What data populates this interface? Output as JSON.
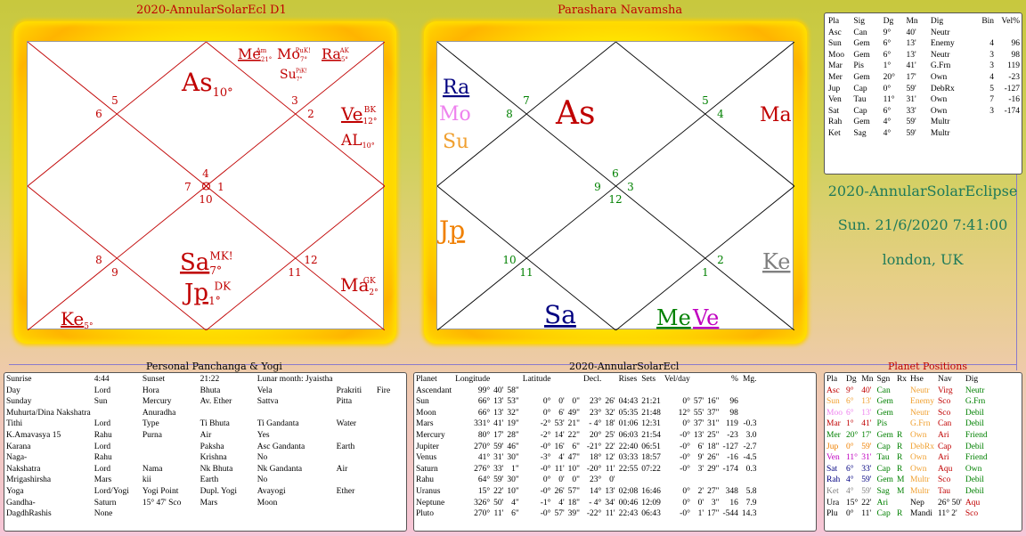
{
  "d1": {
    "title": "2020-AnnularSolarEcl D1",
    "houses": [
      "5",
      "6",
      "3",
      "2",
      "4",
      "7",
      "1",
      "10",
      "8",
      "9",
      "11",
      "12"
    ],
    "planets": [
      {
        "id": "me",
        "text": "Me",
        "sup": "Am",
        "sub": "21°",
        "color": "#c00000",
        "underline": true
      },
      {
        "id": "mo",
        "text": "Mo",
        "sup": "PuK!",
        "sub": "7°",
        "color": "#c00000",
        "underline": false
      },
      {
        "id": "ra",
        "text": "Ra",
        "sup": "AK",
        "sub": "5°",
        "color": "#c00000",
        "underline": true
      },
      {
        "id": "su",
        "text": "Su",
        "sup": "PiK!",
        "sub": "7°",
        "color": "#c00000",
        "underline": false
      },
      {
        "id": "as",
        "text": "As",
        "sup": "",
        "sub": "10°",
        "color": "#c00000",
        "underline": false
      },
      {
        "id": "ve",
        "text": "Ve",
        "sup": "BK",
        "sub": "12°",
        "color": "#c00000",
        "underline": true
      },
      {
        "id": "al",
        "text": "AL",
        "sup": "",
        "sub": "10°",
        "color": "#c00000",
        "underline": false
      },
      {
        "id": "sa",
        "text": "Sa",
        "sup": "MK!",
        "sub": "7°",
        "color": "#c00000",
        "underline": true
      },
      {
        "id": "jp",
        "text": "Jp",
        "sup": "DK",
        "sub": "1°",
        "color": "#c00000",
        "underline": true
      },
      {
        "id": "ma",
        "text": "Ma",
        "sup": "GK",
        "sub": "2°",
        "color": "#c00000",
        "underline": false
      },
      {
        "id": "ke",
        "text": "Ke",
        "sup": "",
        "sub": "5°",
        "color": "#c00000",
        "underline": true
      }
    ]
  },
  "navamsha": {
    "title": "Parashara Navamsha",
    "houses": [
      "7",
      "8",
      "5",
      "4",
      "6",
      "9",
      "3",
      "12",
      "10",
      "11",
      "2",
      "1"
    ],
    "planets": [
      {
        "id": "ra",
        "text": "Ra",
        "color": "#000080",
        "underline": true
      },
      {
        "id": "mo",
        "text": "Mo",
        "color": "#ee82ee",
        "underline": false
      },
      {
        "id": "su",
        "text": "Su",
        "color": "#f0a030",
        "underline": false
      },
      {
        "id": "as",
        "text": "As",
        "color": "#c00000",
        "underline": false
      },
      {
        "id": "ma",
        "text": "Ma",
        "color": "#c00000",
        "underline": false
      },
      {
        "id": "jp",
        "text": "Jp",
        "color": "#f08000",
        "underline": true
      },
      {
        "id": "ke",
        "text": "Ke",
        "color": "#808080",
        "underline": true
      },
      {
        "id": "sa",
        "text": "Sa",
        "color": "#000080",
        "underline": true
      },
      {
        "id": "me",
        "text": "Me",
        "color": "#008000",
        "underline": true
      },
      {
        "id": "ve",
        "text": "Ve",
        "color": "#c000c0",
        "underline": true
      }
    ]
  },
  "planet_table": {
    "headers": [
      "Pla",
      "Sig",
      "Dg",
      "Mn",
      "Dig",
      "Bin",
      "Vel%"
    ],
    "rows": [
      [
        "Asc",
        "Can",
        "9°",
        "40'",
        "Neutr",
        "",
        ""
      ],
      [
        "Sun",
        "Gem",
        "6°",
        "13'",
        "Enemy",
        "4",
        "96"
      ],
      [
        "Moo",
        "Gem",
        "6°",
        "13'",
        "Neutr",
        "3",
        "98"
      ],
      [
        "Mar",
        "Pis",
        "1°",
        "41'",
        "G.Frn",
        "3",
        "119"
      ],
      [
        "Mer",
        "Gem",
        "20°",
        "17'",
        "Own",
        "4",
        "-23"
      ],
      [
        "Jup",
        "Cap",
        "0°",
        "59'",
        "DebRx",
        "5",
        "-127"
      ],
      [
        "Ven",
        "Tau",
        "11°",
        "31'",
        "Own",
        "7",
        "-16"
      ],
      [
        "Sat",
        "Cap",
        "6°",
        "33'",
        "Own",
        "3",
        "-174"
      ],
      [
        "Rah",
        "Gem",
        "4°",
        "59'",
        "Multr",
        "",
        ""
      ],
      [
        "Ket",
        "Sag",
        "4°",
        "59'",
        "Multr",
        "",
        ""
      ]
    ]
  },
  "event": {
    "name": "2020-AnnularSolarEclipse",
    "datetime": "Sun. 21/6/2020  7:41:00",
    "place": "london, UK"
  },
  "panchanga": {
    "title": "Personal Panchanga & Yogi",
    "rows": [
      [
        "Sunrise",
        "4:44",
        "Sunset",
        "21:22",
        "Lunar month: Jyaistha",
        "",
        ""
      ],
      [
        "Day",
        "Lord",
        "Hora",
        "Bhuta",
        "Vela",
        "Prakriti",
        "Fire"
      ],
      [
        "Sunday",
        "Sun",
        "Mercury",
        "Av. Ether",
        "Sattva",
        "Pitta",
        ""
      ],
      [
        "Muhurta/Dina Nakshatra",
        "",
        "Anuradha",
        "",
        "",
        "",
        ""
      ],
      [
        "Tithi",
        "Lord",
        "Type",
        "Ti Bhuta",
        "Ti Gandanta",
        "Water",
        ""
      ],
      [
        "K.Amavasya 15",
        "Rahu",
        "Purna",
        "Air",
        "Yes",
        "",
        ""
      ],
      [
        "Karana",
        "Lord",
        "",
        "Paksha",
        "Asc Gandanta",
        "Earth",
        ""
      ],
      [
        "Naga-",
        "Rahu",
        "",
        "Krishna",
        "No",
        "",
        ""
      ],
      [
        "Nakshatra",
        "Lord",
        "Nama",
        "Nk Bhuta",
        "Nk Gandanta",
        "Air",
        ""
      ],
      [
        "Mrigashirsha",
        "Mars",
        "kii",
        "Earth",
        "No",
        "",
        ""
      ],
      [
        "Yoga",
        "Lord/Yogi",
        "Yogi Point",
        "Dupl. Yogi",
        "Avayogi",
        "Ether",
        ""
      ],
      [
        "Gandha-",
        "Saturn",
        "15° 47' Sco",
        "Mars",
        "Moon",
        "",
        ""
      ],
      [
        "DagdhRashis",
        "None",
        "",
        "",
        "",
        "",
        ""
      ]
    ]
  },
  "ephemeris": {
    "title": "2020-AnnularSolarEcl",
    "headers": [
      "Planet",
      "Longitude",
      "",
      "",
      "Latitude",
      "",
      "",
      "Decl.",
      "",
      "Rises",
      "Sets",
      "Vel/day",
      "",
      "",
      "%",
      "Mg."
    ],
    "rows": [
      [
        "Ascendant",
        "99°",
        "40'",
        "58\"",
        "",
        "",
        "",
        "",
        "",
        "",
        "",
        "",
        "",
        "",
        "",
        ""
      ],
      [
        "Sun",
        "66°",
        "13'",
        "53\"",
        "0°",
        "0'",
        "0\"",
        "23°",
        "26'",
        "04:43",
        "21:21",
        "0°",
        "57'",
        "16\"",
        "96",
        ""
      ],
      [
        "Moon",
        "66°",
        "13'",
        "32\"",
        "0°",
        "6'",
        "49\"",
        "23°",
        "32'",
        "05:35",
        "21:48",
        "12°",
        "55'",
        "37\"",
        "98",
        ""
      ],
      [
        "Mars",
        "331°",
        "41'",
        "19\"",
        "-2°",
        "53'",
        "21\"",
        "- 4°",
        "18'",
        "01:06",
        "12:31",
        "0°",
        "37'",
        "31\"",
        "119",
        "-0.3"
      ],
      [
        "Mercury",
        "80°",
        "17'",
        "28\"",
        "-2°",
        "14'",
        "22\"",
        "20°",
        "25'",
        "06:03",
        "21:54",
        "-0°",
        "13'",
        "25\"",
        "-23",
        "3.0"
      ],
      [
        "Jupiter",
        "270°",
        "59'",
        "46\"",
        "-0°",
        "16'",
        "6\"",
        "-21°",
        "22'",
        "22:40",
        "06:51",
        "-0°",
        "6'",
        "18\"",
        "-127",
        "-2.7"
      ],
      [
        "Venus",
        "41°",
        "31'",
        "30\"",
        "-3°",
        "4'",
        "47\"",
        "18°",
        "12'",
        "03:33",
        "18:57",
        "-0°",
        "9'",
        "26\"",
        "-16",
        "-4.5"
      ],
      [
        "Saturn",
        "276°",
        "33'",
        "1\"",
        "-0°",
        "11'",
        "10\"",
        "-20°",
        "11'",
        "22:55",
        "07:22",
        "-0°",
        "3'",
        "29\"",
        "-174",
        "0.3"
      ],
      [
        "Rahu",
        "64°",
        "59'",
        "30\"",
        "0°",
        "0'",
        "0\"",
        "23°",
        "0'",
        "",
        "",
        "",
        "",
        "",
        "",
        ""
      ],
      [
        "Uranus",
        "15°",
        "22'",
        "10\"",
        "-0°",
        "26'",
        "57\"",
        "14°",
        "13'",
        "02:08",
        "16:46",
        "0°",
        "2'",
        "27\"",
        "348",
        "5.8"
      ],
      [
        "Neptune",
        "326°",
        "50'",
        "4\"",
        "-1°",
        "4'",
        "18\"",
        "- 4°",
        "34'",
        "00:46",
        "12:09",
        "0°",
        "0'",
        "3\"",
        "16",
        "7.9"
      ],
      [
        "Pluto",
        "270°",
        "11'",
        "6\"",
        "-0°",
        "57'",
        "39\"",
        "-22°",
        "11'",
        "22:43",
        "06:43",
        "-0°",
        "1'",
        "17\"",
        "-544",
        "14.3"
      ]
    ]
  },
  "positions": {
    "title": "Planet Positions",
    "headers": [
      "Pla",
      "Dg",
      "Mn",
      "Sgn",
      "Rx",
      "Hse",
      "Nav",
      "Dig"
    ],
    "rows": [
      {
        "cells": [
          "Asc",
          "9°",
          "40'",
          "Can",
          "",
          "Neutr",
          "Virg",
          "Neutr"
        ],
        "color": "#c00000"
      },
      {
        "cells": [
          "Sun",
          "6°",
          "13'",
          "Gem",
          "",
          "Enemy",
          "Sco",
          "G.Frn"
        ],
        "color": "#f0a030"
      },
      {
        "cells": [
          "Moo",
          "6°",
          "13'",
          "Gem",
          "",
          "Neutr",
          "Sco",
          "Debil"
        ],
        "color": "#ee82ee"
      },
      {
        "cells": [
          "Mar",
          "1°",
          "41'",
          "Pis",
          "",
          "G.Frn",
          "Can",
          "Debil"
        ],
        "color": "#c00000"
      },
      {
        "cells": [
          "Mer",
          "20°",
          "17'",
          "Gem",
          "R",
          "Own",
          "Ari",
          "Friend"
        ],
        "color": "#008000"
      },
      {
        "cells": [
          "Jup",
          "0°",
          "59'",
          "Cap",
          "R",
          "DebRx",
          "Cap",
          "Debil"
        ],
        "color": "#f08000"
      },
      {
        "cells": [
          "Ven",
          "11°",
          "31'",
          "Tau",
          "R",
          "Own",
          "Ari",
          "Friend"
        ],
        "color": "#c000c0"
      },
      {
        "cells": [
          "Sat",
          "6°",
          "33'",
          "Cap",
          "R",
          "Own",
          "Aqu",
          "Own"
        ],
        "color": "#000080"
      },
      {
        "cells": [
          "Rah",
          "4°",
          "59'",
          "Gem",
          "M",
          "Multr",
          "Sco",
          "Debil"
        ],
        "color": "#000080"
      },
      {
        "cells": [
          "Ket",
          "4°",
          "59'",
          "Sag",
          "M",
          "Multr",
          "Tau",
          "Debil"
        ],
        "color": "#808080"
      },
      {
        "cells": [
          "Ura",
          "15°",
          "22'",
          "Ari",
          "",
          "Nep",
          "26° 50'",
          "Aqu"
        ],
        "color": "#000000"
      },
      {
        "cells": [
          "Plu",
          "0°",
          "11'",
          "Cap",
          "R",
          "Mandi",
          "11° 2'",
          "Sco"
        ],
        "color": "#000000"
      }
    ]
  },
  "colors": {
    "d1_ink": "#c00000",
    "nav_house_ink": "#008000",
    "event_ink": "#1f7a5a",
    "frame_yellow": "#fff200",
    "title_red": "#c00000"
  }
}
